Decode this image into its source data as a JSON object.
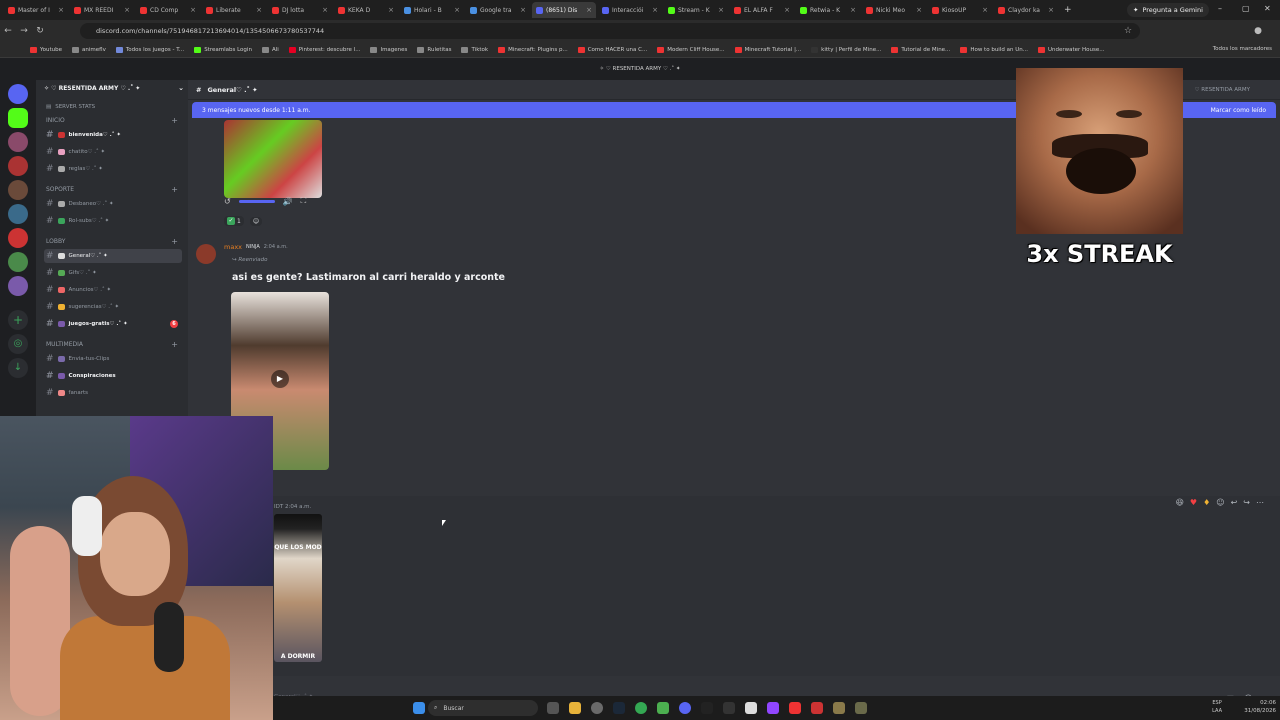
{
  "browser": {
    "tabs": [
      {
        "label": "Master of I",
        "color": "#e33"
      },
      {
        "label": "MX REEDI",
        "color": "#e33"
      },
      {
        "label": "CD Comp",
        "color": "#e33"
      },
      {
        "label": "Liberate",
        "color": "#e33"
      },
      {
        "label": "DJ lotta",
        "color": "#e33"
      },
      {
        "label": "KEKA D",
        "color": "#e33"
      },
      {
        "label": "Holari - B",
        "color": "#4a90e2"
      },
      {
        "label": "Google tra",
        "color": "#4a90e2"
      },
      {
        "label": "(8651) Dis",
        "color": "#5865f2"
      },
      {
        "label": "Interacciói",
        "color": "#5865f2"
      },
      {
        "label": "Stream - K",
        "color": "#53fc18"
      },
      {
        "label": "EL ALFA F",
        "color": "#e33"
      },
      {
        "label": "Retwia - K",
        "color": "#53fc18"
      },
      {
        "label": "Nicki Meo",
        "color": "#e33"
      },
      {
        "label": "KiosoUP",
        "color": "#e33"
      },
      {
        "label": "Claydor ka",
        "color": "#e33"
      }
    ],
    "gemini_label": "Pregunta a Gemini",
    "url": "discord.com/channels/751946817213694014/1354506673780537744",
    "bookmarks": [
      "Youtube",
      "animeflv",
      "Todos los juegos - T...",
      "Streamlabs Login",
      "Ali",
      "Pinterest: descubre l...",
      "Imagenes",
      "Ruletitas",
      "Tiktok",
      "Minecraft: Plugins p...",
      "Como HACER una C...",
      "Modern Cliff House...",
      "Minecraft Tutorial |...",
      "kitty | Perfil de Mine...",
      "Tutorial de Mine...",
      "How to build an Un...",
      "Underwater House..."
    ],
    "all_bookmarks": "Todos los marcadores"
  },
  "discord": {
    "top_title": "✧ ♡ RESENTIDA ARMY ♡ .˚ ✦",
    "server_name": "✧ ♡ RESENTIDA ARMY ♡ .˚ ✦",
    "server_stats": "SERVER STATS",
    "categories": [
      {
        "label": "INICIO",
        "channels": [
          {
            "label": "bienvenida♡ .˚ ✦",
            "bold": true
          },
          {
            "label": "chatito♡ .˚ ✦"
          },
          {
            "label": "reglas♡ .˚ ✦"
          }
        ]
      },
      {
        "label": "SOPORTE",
        "channels": [
          {
            "label": "Desbaneo♡ .˚ ✦"
          },
          {
            "label": "Rol-subs♡ .˚ ✦"
          }
        ]
      },
      {
        "label": "LOBBY",
        "channels": [
          {
            "label": "General♡ .˚ ✦",
            "active": true
          },
          {
            "label": "Gifs♡ .˚ ✦"
          },
          {
            "label": "Anuncios♡ .˚ ✦"
          },
          {
            "label": "sugerencias♡ .˚ ✦"
          },
          {
            "label": "juegos-gratis♡ .˚ ✦",
            "bold": true,
            "badge": "6"
          }
        ]
      },
      {
        "label": "MULTIMEDIA",
        "channels": [
          {
            "label": "Envia-tus-Clips"
          },
          {
            "label": "Conspiraciones",
            "bold": true
          },
          {
            "label": "fanarts"
          }
        ]
      }
    ],
    "channel_header": "General♡ .˚ ✦",
    "header_right": "♡ RESENTIDA ARMY",
    "new_messages": "3 mensajes nuevos desde 1:11 a.m.",
    "mark_read": "Marcar como leído",
    "reaction_count": "1",
    "message": {
      "user": "maxx",
      "tag": "NINJA",
      "time": "2:04 a.m.",
      "forwarded": "Reenviado",
      "text": "asi es gente? Lastimaron al carri heraldo y arconte"
    },
    "message2": {
      "user": "IDT",
      "time": "2:04 a.m.",
      "caption_top": "QUE LOS MOD",
      "caption_bottom": "A DORMIR"
    },
    "input_label": "General♡ .˚ ✦"
  },
  "overlay": {
    "streak": "3x STREAK"
  },
  "taskbar": {
    "search": "Buscar",
    "lang": "ESP",
    "lang2": "LAA",
    "time": "02:06",
    "date": "31/08/2026"
  }
}
